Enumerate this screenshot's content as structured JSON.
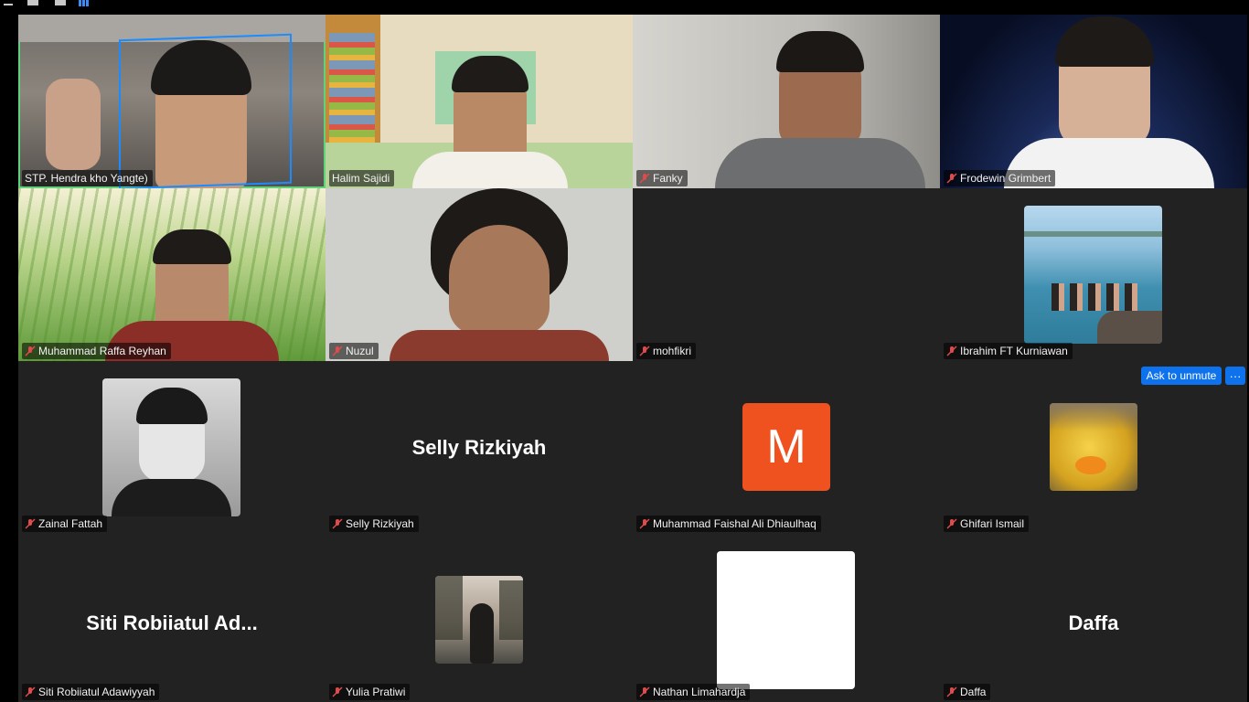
{
  "window": {
    "icons": [
      "minimize-icon",
      "restore-icon",
      "window-icon",
      "gallery-view-icon"
    ]
  },
  "participants": [
    {
      "name": "STP. Hendra kho  Yangte)",
      "muted": false,
      "active": true
    },
    {
      "name": "Halim Sajidi",
      "muted": false
    },
    {
      "name": "Fanky",
      "muted": true
    },
    {
      "name": "Frodewin Grimbert",
      "muted": true
    },
    {
      "name": "Muhammad Raffa Reyhan",
      "muted": true
    },
    {
      "name": "Nuzul",
      "muted": true
    },
    {
      "name": "mohfikri",
      "muted": true
    },
    {
      "name": "Ibrahim FT Kurniawan",
      "muted": true
    },
    {
      "name": "Zainal Fattah",
      "muted": true
    },
    {
      "name": "Selly Rizkiyah",
      "muted": true,
      "display_name": "Selly Rizkiyah"
    },
    {
      "name": "Muhammad Faishal Ali Dhiaulhaq",
      "muted": true,
      "avatar_letter": "M"
    },
    {
      "name": "Ghifari Ismail",
      "muted": true
    },
    {
      "name": "Siti Robiiatul Adawiyyah",
      "muted": true,
      "display_name": "Siti  Robiiatul  Ad..."
    },
    {
      "name": "Yulia Pratiwi",
      "muted": true
    },
    {
      "name": "Nathan Limahardja",
      "muted": true
    },
    {
      "name": "Daffa",
      "muted": true,
      "display_name": "Daffa"
    }
  ],
  "hover_actions": {
    "ask_to_unmute": "Ask to unmute",
    "more": "···"
  },
  "colors": {
    "active_speaker": "#5fd37a",
    "button": "#0e72ed",
    "letter_avatar": "#f0521f",
    "mute_icon": "#e04a4a"
  }
}
